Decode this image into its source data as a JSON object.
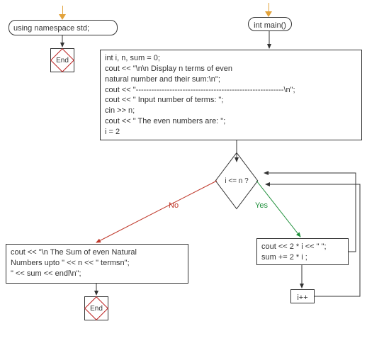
{
  "left_branch": {
    "namespace_box": "using namespace std;",
    "end_label": "End"
  },
  "main_entry": "int main()",
  "setup_box": {
    "l1": "int i, n, sum = 0;",
    "l2": "cout << \"\\n\\n Display n terms of even",
    "l3": "natural number and their sum:\\n\";",
    "l4": "cout << \"---------------------------------------------------------\\n\";",
    "l5": "cout << \" Input number of terms: \";",
    "l6": "cin >> n;",
    "l7": "cout << \" The even numbers are: \";",
    "l8": "i = 2"
  },
  "decision": {
    "condition": "i <= n ?",
    "no_label": "No",
    "yes_label": "Yes"
  },
  "loop_body": {
    "l1": "cout << 2 * i << \" \";",
    "l2": "sum += 2 * i ;"
  },
  "increment": "i++",
  "output_box": {
    "l1": "cout << \"\\n The Sum of even Natural",
    "l2": "Numbers upto \" << n << \" termsn\";",
    "l3": "\" << sum << endl\\n\";"
  },
  "end_label2": "End"
}
